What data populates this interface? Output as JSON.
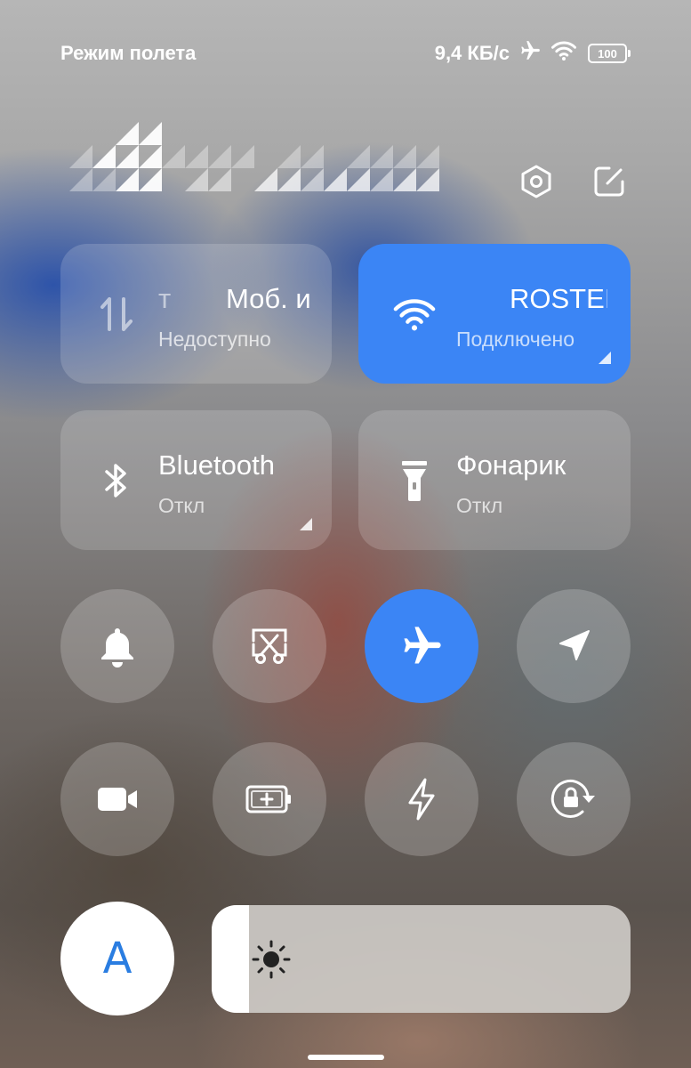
{
  "status_bar": {
    "mode": "Режим полета",
    "speed": "9,4 КБ/с",
    "battery": "100"
  },
  "tiles": {
    "mobile": {
      "title": "Моб. и",
      "title_left_fragment": "т",
      "subtitle": "Недоступно",
      "icon": "data-arrows-icon",
      "active": false
    },
    "wifi": {
      "title": "ROSTEI",
      "subtitle": "Подключено",
      "icon": "wifi-icon",
      "active": true
    },
    "bluetooth": {
      "title": "Bluetooth",
      "subtitle": "Откл",
      "icon": "bluetooth-icon",
      "active": false
    },
    "flashlight": {
      "title": "Фонарик",
      "subtitle": "Откл",
      "icon": "flashlight-icon",
      "active": false
    }
  },
  "toggles": [
    {
      "icon": "bell-icon",
      "active": false
    },
    {
      "icon": "screenshot-scissors-icon",
      "active": false
    },
    {
      "icon": "airplane-icon",
      "active": true
    },
    {
      "icon": "location-icon",
      "active": false
    },
    {
      "icon": "video-camera-icon",
      "active": false
    },
    {
      "icon": "battery-saver-icon",
      "active": false
    },
    {
      "icon": "lightning-icon",
      "active": false
    },
    {
      "icon": "rotation-lock-icon",
      "active": false
    }
  ],
  "auto_brightness": {
    "label": "A"
  },
  "brightness": {
    "level_percent": 9
  },
  "colors": {
    "accent": "#3b85f5",
    "auto_text": "#2a7de1"
  }
}
